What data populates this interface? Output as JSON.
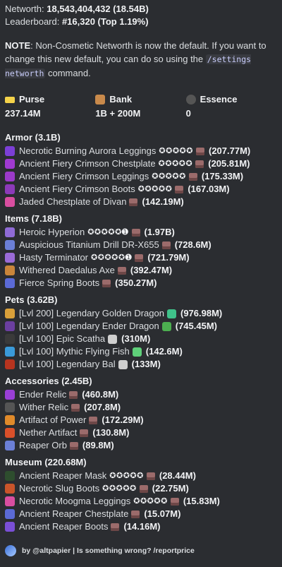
{
  "header": {
    "networth_label": "Networth: ",
    "networth_value": "18,543,404,432 (18.54B)",
    "leaderboard_label": "Leaderboard: ",
    "leaderboard_value": "#16,320 (Top 1.19%)"
  },
  "note": {
    "prefix": "NOTE",
    "text1": ": Non-Cosmetic Networth is now the default. If you want to change this new default, you can do so using the ",
    "command": "/settings networth",
    "text2": " command."
  },
  "fields": [
    {
      "name": "Purse",
      "value": "237.14M",
      "icon": "purse-icon",
      "color": "#f5d34a"
    },
    {
      "name": "Bank",
      "value": "1B + 200M",
      "icon": "bank-icon",
      "color": "#c98a4b"
    },
    {
      "name": "Essence",
      "value": "0",
      "icon": "essence-icon",
      "color": "#555555"
    }
  ],
  "sections": {
    "armor": {
      "title": "Armor (3.1B)",
      "items": [
        {
          "name": "Necrotic Burning Aurora Leggings",
          "stars": "✪✪✪✪✪",
          "price": "(207.77M)",
          "color": "#7c3fd6"
        },
        {
          "name": "Ancient Fiery Crimson Chestplate",
          "stars": "✪✪✪✪✪",
          "price": "(205.81M)",
          "color": "#a03ad1"
        },
        {
          "name": "Ancient Fiery Crimson Leggings",
          "stars": "✪✪✪✪✪",
          "price": "(175.33M)",
          "color": "#9b3ac9"
        },
        {
          "name": "Ancient Fiery Crimson Boots",
          "stars": "✪✪✪✪✪",
          "price": "(167.03M)",
          "color": "#8c3ab8"
        },
        {
          "name": "Jaded Chestplate of Divan",
          "stars": "",
          "price": "(142.19M)",
          "color": "#d94ea0"
        }
      ]
    },
    "items": {
      "title": "Items (7.18B)",
      "items": [
        {
          "name": "Heroic Hyperion",
          "stars": "✪✪✪✪✪➊",
          "price": "(1.97B)",
          "color": "#8f6bd6"
        },
        {
          "name": "Auspicious Titanium Drill DR-X655",
          "stars": "",
          "price": "(728.6M)",
          "color": "#6b7fd6"
        },
        {
          "name": "Hasty Terminator",
          "stars": "✪✪✪✪✪➊",
          "price": "(721.79M)",
          "color": "#9a6bd6"
        },
        {
          "name": "Withered Daedalus Axe",
          "stars": "",
          "price": "(392.47M)",
          "color": "#c9853a"
        },
        {
          "name": "Fierce Spring Boots",
          "stars": "",
          "price": "(350.27M)",
          "color": "#5b6ad6"
        }
      ]
    },
    "pets": {
      "title": "Pets (3.62B)",
      "items": [
        {
          "name": "[Lvl 200] Legendary Golden Dragon",
          "badge": "clover-icon",
          "badge_color": "#3fc28a",
          "price": "(976.98M)",
          "color": "#d9a03a"
        },
        {
          "name": "[Lvl 100] Legendary Ender Dragon",
          "badge": "cube-icon",
          "badge_color": "#4caf50",
          "price": "(745.45M)",
          "color": "#6b3fa0"
        },
        {
          "name": "[Lvl 100] Epic Scatha",
          "badge": "gem-icon",
          "badge_color": "#cfcfcf",
          "price": "(310M)",
          "color": "#3a3a3a"
        },
        {
          "name": "[Lvl 100] Mythic Flying Fish",
          "badge": "cube-icon",
          "badge_color": "#5fd07a",
          "price": "(142.6M)",
          "color": "#3a9ad9"
        },
        {
          "name": "[Lvl 100] Legendary Bal",
          "badge": "gem-icon",
          "badge_color": "#cfcfcf",
          "price": "(133M)",
          "color": "#b8341f"
        }
      ]
    },
    "accessories": {
      "title": "Accessories (2.45B)",
      "items": [
        {
          "name": "Ender Relic",
          "stars": "",
          "price": "(460.8M)",
          "color": "#9a3fd6"
        },
        {
          "name": "Wither Relic",
          "stars": "",
          "price": "(207.8M)",
          "color": "#555555"
        },
        {
          "name": "Artifact of Power",
          "stars": "",
          "price": "(172.29M)",
          "color": "#e08a2a"
        },
        {
          "name": "Nether Artifact",
          "stars": "",
          "price": "(130.8M)",
          "color": "#d9502a"
        },
        {
          "name": "Reaper Orb",
          "stars": "",
          "price": "(89.8M)",
          "color": "#6b7fd6"
        }
      ]
    },
    "museum": {
      "title": "Museum (220.68M)",
      "items": [
        {
          "name": "Ancient Reaper Mask",
          "stars": "✪✪✪✪✪",
          "price": "(28.44M)",
          "color": "#2e4d2e"
        },
        {
          "name": "Necrotic Slug Boots",
          "stars": "✪✪✪✪✪",
          "price": "(22.75M)",
          "color": "#c9542a"
        },
        {
          "name": "Necrotic Moogma Leggings",
          "stars": "✪✪✪✪✪",
          "price": "(15.83M)",
          "color": "#d94ea0"
        },
        {
          "name": "Ancient Reaper Chestplate",
          "stars": "",
          "price": "(15.07M)",
          "color": "#5b6ad6"
        },
        {
          "name": "Ancient Reaper Boots",
          "stars": "",
          "price": "(14.16M)",
          "color": "#7a4fd6"
        }
      ]
    }
  },
  "footer": {
    "text": "by @altpapier | Is something wrong? /reportprice"
  }
}
